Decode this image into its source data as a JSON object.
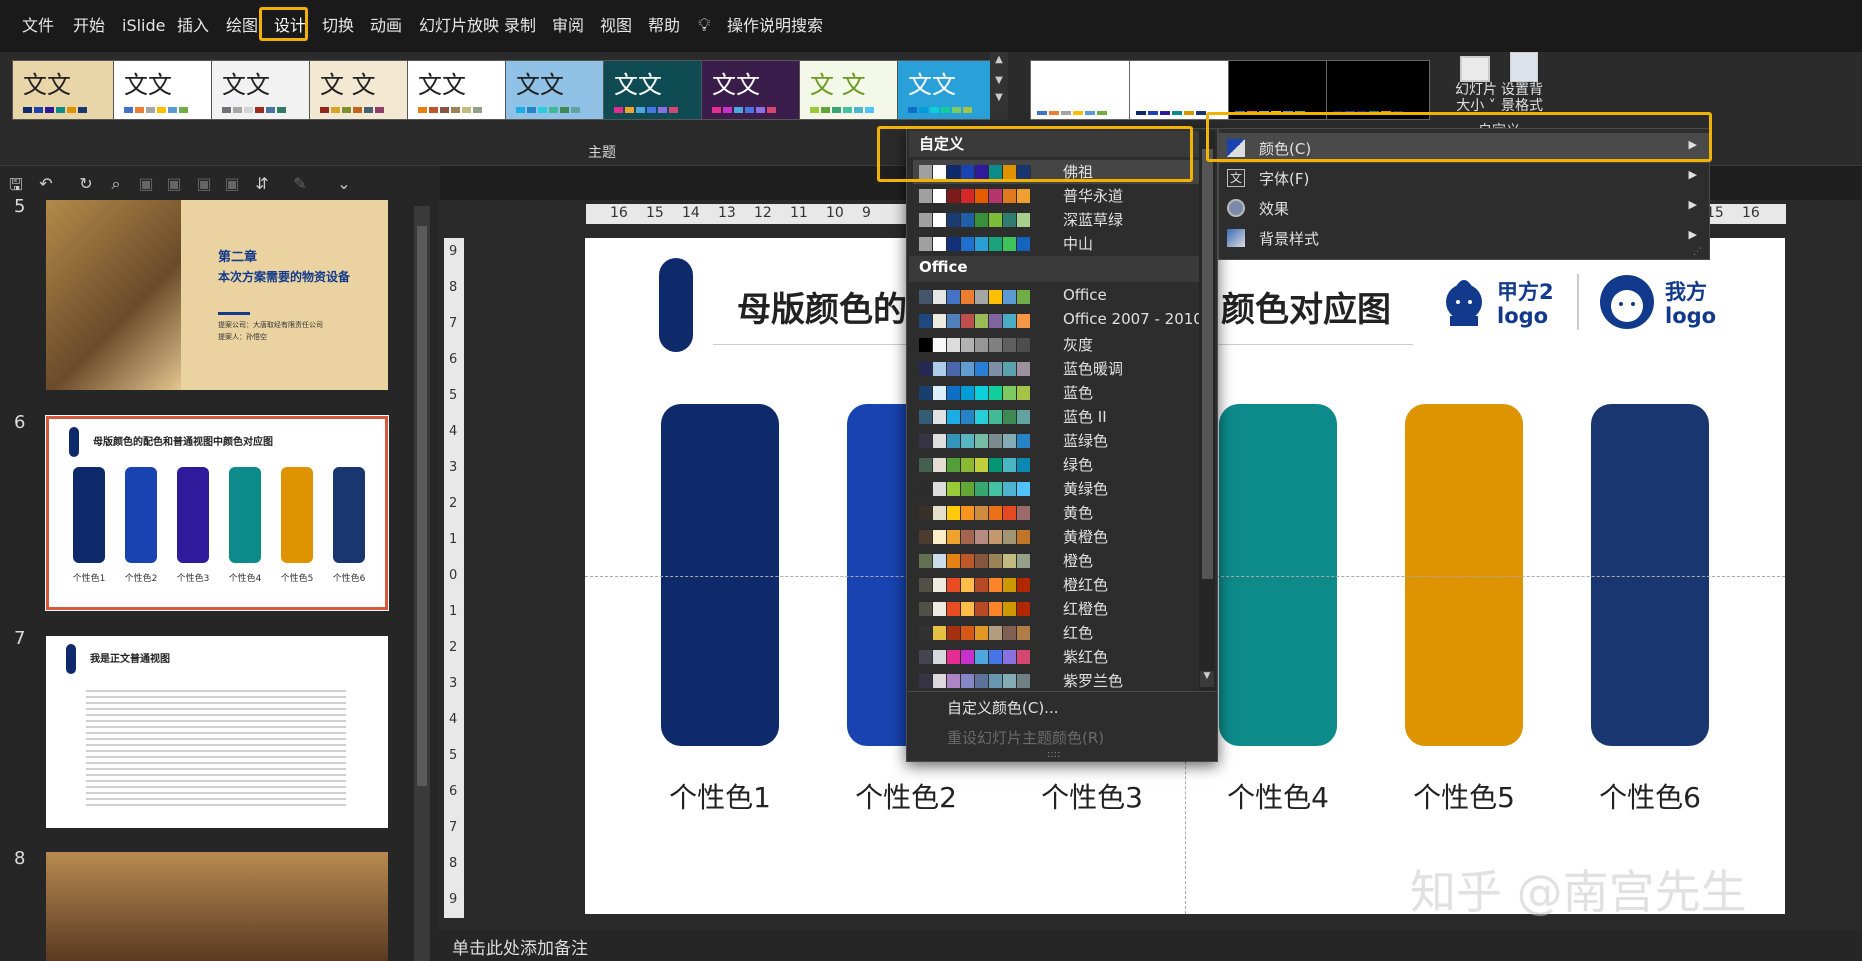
{
  "menubar": {
    "items": [
      "文件",
      "开始",
      "iSlide",
      "插入",
      "绘图",
      "设计",
      "切换",
      "动画",
      "幻灯片放映",
      "录制",
      "审阅",
      "视图",
      "帮助"
    ],
    "active": "设计",
    "search_label": "操作说明搜索"
  },
  "ribbon": {
    "theme_group_label": "主题",
    "theme_sample_text": "文文",
    "theme_sample_text_alt": "文 文",
    "customize_group_label": "自定义",
    "slide_size_label": "幻灯片\n大小",
    "slide_size_line1": "幻灯片",
    "slide_size_line2": "大小",
    "format_bg_line1": "设置背",
    "format_bg_line2": "景格式"
  },
  "slides": [
    {
      "num": "5",
      "chapter": "第二章",
      "title": "本次方案需要的物资设备",
      "company": "提案公司：大唐取经有限责任公司",
      "presenter": "提案人：孙悟空"
    },
    {
      "num": "6",
      "title": "母版颜色的配色和普通视图中颜色对应图",
      "labels": [
        "个性色1",
        "个性色2",
        "个性色3",
        "个性色4",
        "个性色5",
        "个性色6"
      ]
    },
    {
      "num": "7",
      "title": "我是正文普通视图"
    },
    {
      "num": "8"
    }
  ],
  "logo": {
    "party_a": "甲方2\nlogo",
    "party_a_line1": "甲方2",
    "party_a_line2": "logo",
    "our": "我方",
    "our_line2": "logo"
  },
  "ruler_h": [
    "16",
    "15",
    "14",
    "13",
    "12",
    "11",
    "10",
    "9",
    "15",
    "16"
  ],
  "ruler_v": [
    "9",
    "8",
    "7",
    "6",
    "5",
    "4",
    "3",
    "2",
    "1",
    "0",
    "1",
    "2",
    "3",
    "4",
    "5",
    "6",
    "7",
    "8",
    "9"
  ],
  "main_slide": {
    "title_left": "母版颜色的",
    "title_right": "颜色对应图",
    "accent_colors": [
      "#0f2a6b",
      "#1843b0",
      "#2e1a9a",
      "#0d8a8a",
      "#de9400",
      "#1a3670"
    ],
    "accent_labels": [
      "个性色1",
      "个性色2",
      "个性色3",
      "个性色4",
      "个性色5",
      "个性色6"
    ]
  },
  "notes": {
    "placeholder": "单击此处添加备注"
  },
  "colors_dropdown": {
    "section_custom": "自定义",
    "section_office": "Office",
    "custom_items": [
      {
        "name": "佛祖",
        "colors": [
          "#a0a0a0",
          "#ffffff",
          "#0f2a6b",
          "#1843b0",
          "#2e1a9a",
          "#0d8a8a",
          "#de9400",
          "#1a3670"
        ]
      },
      {
        "name": "普华永道",
        "colors": [
          "#a0a0a0",
          "#ffffff",
          "#7d1a1a",
          "#d62828",
          "#e65c00",
          "#b5356a",
          "#e07a1f",
          "#f0a030"
        ]
      },
      {
        "name": "深蓝草绿",
        "colors": [
          "#a0a0a0",
          "#ffffff",
          "#1b3b73",
          "#1f5fa8",
          "#3a8f3a",
          "#7cbd3a",
          "#2e7d6f",
          "#a8d08d"
        ]
      },
      {
        "name": "中山",
        "colors": [
          "#a0a0a0",
          "#ffffff",
          "#13307a",
          "#1f6fcf",
          "#2a9fd6",
          "#1aa37a",
          "#3ec25a",
          "#1565c0"
        ]
      }
    ],
    "office_items": [
      {
        "name": "Office",
        "colors": [
          "#44546a",
          "#e7e6e6",
          "#4472c4",
          "#ed7d31",
          "#a5a5a5",
          "#ffc000",
          "#5b9bd5",
          "#70ad47"
        ]
      },
      {
        "name": "Office 2007 - 2010",
        "colors": [
          "#1f497d",
          "#eeece1",
          "#4f81bd",
          "#c0504d",
          "#9bbb59",
          "#8064a2",
          "#4bacc6",
          "#f79646"
        ]
      },
      {
        "name": "灰度",
        "colors": [
          "#000000",
          "#f8f8f8",
          "#dddddd",
          "#b2b2b2",
          "#969696",
          "#808080",
          "#5f5f5f",
          "#4d4d4d"
        ]
      },
      {
        "name": "蓝色暖调",
        "colors": [
          "#242852",
          "#acccea",
          "#4a66ac",
          "#629dd1",
          "#297fd5",
          "#7f8fa9",
          "#5aa2ae",
          "#9d90a0"
        ]
      },
      {
        "name": "蓝色",
        "colors": [
          "#17406d",
          "#dbefff",
          "#0f6fc6",
          "#009dd9",
          "#0bd0d9",
          "#10cf9b",
          "#7cca62",
          "#a5c249"
        ]
      },
      {
        "name": "蓝色 II",
        "colors": [
          "#335b74",
          "#dfe3e5",
          "#1cade4",
          "#2683c6",
          "#27ced7",
          "#42ba97",
          "#3e8853",
          "#62a39f"
        ]
      },
      {
        "name": "蓝绿色",
        "colors": [
          "#373545",
          "#dedede",
          "#3494ba",
          "#58b6c0",
          "#75bda7",
          "#7a8c8e",
          "#84acb6",
          "#2683c6"
        ]
      },
      {
        "name": "绿色",
        "colors": [
          "#455f51",
          "#e3ded1",
          "#549e39",
          "#8ab833",
          "#c0cf3a",
          "#029676",
          "#4ab5c4",
          "#0989b1"
        ]
      },
      {
        "name": "黄绿色",
        "colors": [
          "#2c2c2c",
          "#dddddd",
          "#99cb38",
          "#63a537",
          "#37a76f",
          "#44c1a3",
          "#4eb3cf",
          "#51c3f9"
        ]
      },
      {
        "name": "黄色",
        "colors": [
          "#39302a",
          "#e5dec9",
          "#ffca08",
          "#f8931d",
          "#ce8d3e",
          "#ec7016",
          "#e64823",
          "#9c6a6a"
        ]
      },
      {
        "name": "黄橙色",
        "colors": [
          "#4e3b30",
          "#fbeec9",
          "#f0a22e",
          "#a5644e",
          "#b58b80",
          "#c3986d",
          "#a19574",
          "#c17529"
        ]
      },
      {
        "name": "橙色",
        "colors": [
          "#637052",
          "#ccddea",
          "#e48312",
          "#bd582c",
          "#865640",
          "#9b8357",
          "#c2bc80",
          "#94a088"
        ]
      },
      {
        "name": "橙红色",
        "colors": [
          "#505046",
          "#eeece1",
          "#e84c22",
          "#ffbd47",
          "#b64926",
          "#ff8427",
          "#cc9900",
          "#b22600"
        ]
      },
      {
        "name": "红橙色",
        "colors": [
          "#505046",
          "#eeece1",
          "#e84c22",
          "#ffbd47",
          "#b64926",
          "#ff8427",
          "#cc9900",
          "#b22600"
        ]
      },
      {
        "name": "红色",
        "colors": [
          "#323232",
          "#e5c243",
          "#a5300f",
          "#d55816",
          "#e19825",
          "#b19c7d",
          "#7f5f52",
          "#b27d49"
        ]
      },
      {
        "name": "紫红色",
        "colors": [
          "#454551",
          "#d8d9dc",
          "#e32d91",
          "#c830cc",
          "#4ea6dc",
          "#4775e7",
          "#8971e1",
          "#d54773"
        ]
      },
      {
        "name": "紫罗兰色",
        "colors": [
          "#373545",
          "#dcd8dc",
          "#ad84c6",
          "#8784c7",
          "#5d739a",
          "#6997af",
          "#84acb6",
          "#6f8183"
        ]
      }
    ],
    "custom_colors_link": "自定义颜色(C)...",
    "reset_link": "重设幻灯片主题颜色(R)"
  },
  "variant_menu": {
    "items": [
      "颜色(C)",
      "字体(F)",
      "效果",
      "背景样式"
    ]
  },
  "watermark": "知乎 @南宫先生"
}
